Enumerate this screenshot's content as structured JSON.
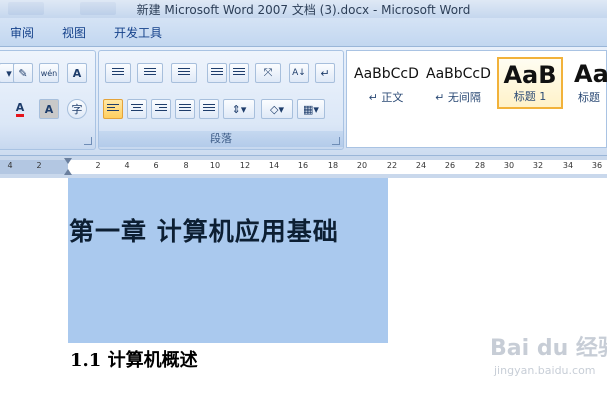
{
  "window": {
    "title": "新建 Microsoft Word 2007 文档 (3).docx - Microsoft Word"
  },
  "tabs": [
    "审阅",
    "视图",
    "开发工具"
  ],
  "ribbon": {
    "paragraph_group_label": "段落",
    "styles": [
      {
        "sample": "AaBbCcD",
        "name": "↵ 正文"
      },
      {
        "sample": "AaBbCcD",
        "name": "↵ 无间隔"
      },
      {
        "sample": "AaB",
        "name": "标题 1"
      },
      {
        "sample": "AaE",
        "name": "标题"
      }
    ],
    "font_buttons": {
      "phonetic": "wén",
      "char_border": "A",
      "font_color": "A",
      "char_shading": "A",
      "enclose": "字"
    }
  },
  "ruler": {
    "ticks": [
      "4",
      "2",
      "2",
      "4",
      "6",
      "8",
      "10",
      "12",
      "14",
      "16",
      "18",
      "20",
      "22",
      "24",
      "26",
      "28",
      "30",
      "32",
      "34",
      "36"
    ]
  },
  "document": {
    "heading": "第一章  计算机应用基础",
    "subheading": "1.1 计算机概述"
  },
  "watermark": {
    "logo": "Bai du 经验",
    "url": "jingyan.baidu.com"
  }
}
